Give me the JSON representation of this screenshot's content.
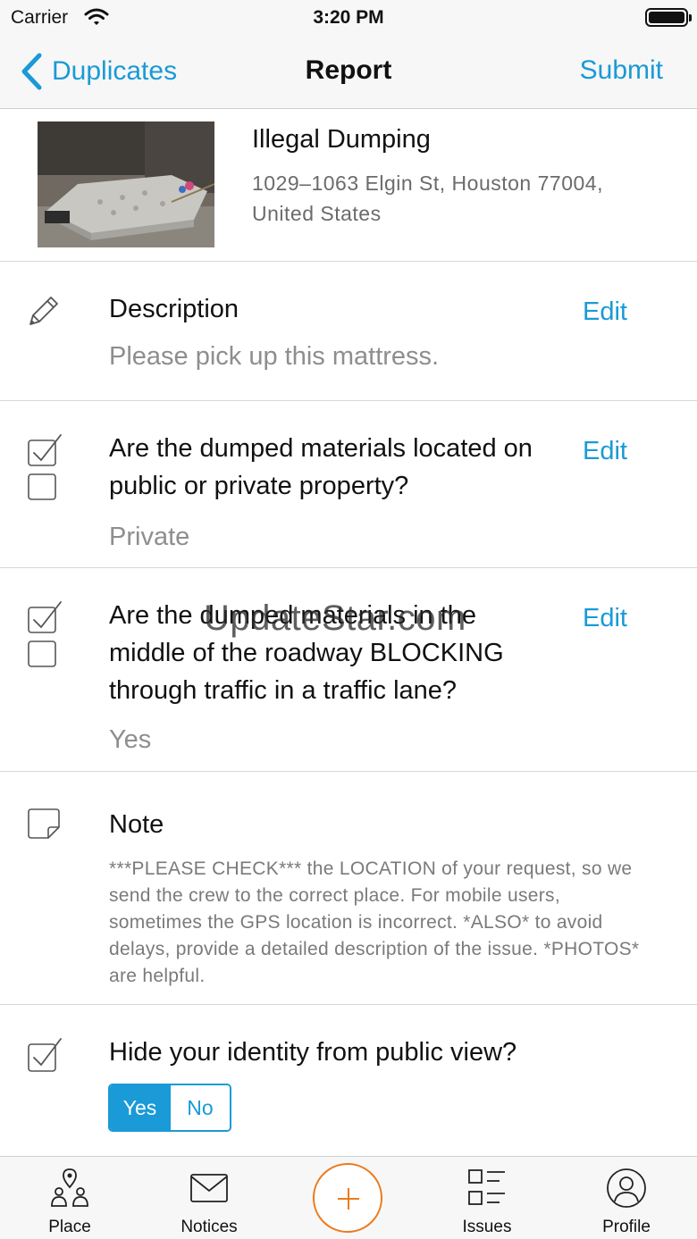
{
  "status_bar": {
    "carrier": "Carrier",
    "time": "3:20 PM"
  },
  "nav": {
    "back_label": "Duplicates",
    "title": "Report",
    "submit_label": "Submit"
  },
  "report": {
    "type": "Illegal Dumping",
    "address": "1029–1063 Elgin St, Houston 77004, United States"
  },
  "description": {
    "title": "Description",
    "value": "Please pick up this mattress.",
    "edit_label": "Edit"
  },
  "question1": {
    "title": "Are the dumped materials located on public or private property?",
    "value": "Private",
    "edit_label": "Edit"
  },
  "question2": {
    "title": "Are the dumped materials in the middle of the roadway BLOCKING through traffic in a traffic lane?",
    "value": "Yes",
    "edit_label": "Edit"
  },
  "note": {
    "title": "Note",
    "text": "***PLEASE CHECK*** the LOCATION of your request, so we send the crew to the correct place. For mobile users, sometimes the GPS location is incorrect. *ALSO* to avoid delays, provide a detailed description of the issue. *PHOTOS* are helpful."
  },
  "privacy": {
    "title": "Hide your identity from public view?",
    "yes_label": "Yes",
    "no_label": "No",
    "selected": "Yes"
  },
  "watermark": "UpdateStar.com",
  "tabs": [
    {
      "label": "Place",
      "icon": "place-icon"
    },
    {
      "label": "Notices",
      "icon": "envelope-icon"
    },
    {
      "label": "",
      "icon": "plus-icon"
    },
    {
      "label": "Issues",
      "icon": "list-icon"
    },
    {
      "label": "Profile",
      "icon": "profile-icon"
    }
  ],
  "colors": {
    "accent": "#1a9ad6",
    "fab": "#ec7a1c",
    "muted_text": "#8e8e8e"
  }
}
